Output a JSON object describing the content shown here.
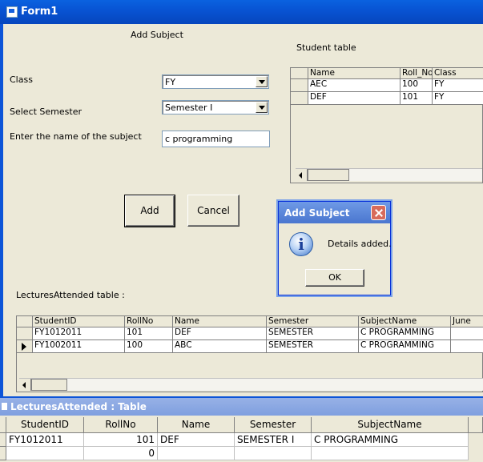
{
  "window": {
    "title": "Form1"
  },
  "form": {
    "heading": "Add Subject",
    "student_table_label": "Student table",
    "class_label": "Class",
    "class_value": "FY",
    "semester_label": "Select Semester",
    "semester_value": "Semester I",
    "subject_label": "Enter the name of the subject",
    "subject_value": "c programming",
    "add_button": "Add",
    "cancel_button": "Cancel",
    "lectures_label": "LecturesAttended table :"
  },
  "student_grid": {
    "columns": [
      "Name",
      "Roll_No",
      "Class"
    ],
    "rows": [
      [
        "AEC",
        "100",
        "FY"
      ],
      [
        "DEF",
        "101",
        "FY"
      ]
    ]
  },
  "lectures_grid": {
    "columns": [
      "StudentID",
      "RollNo",
      "Name",
      "Semester",
      "SubjectName",
      "June"
    ],
    "rows": [
      [
        "FY1012011",
        "101",
        "DEF",
        "SEMESTER",
        "C PROGRAMMING",
        ""
      ],
      [
        "FY1002011",
        "100",
        "ABC",
        "SEMESTER",
        "C PROGRAMMING",
        ""
      ]
    ],
    "selected_row": 1
  },
  "dialog": {
    "title": "Add Subject",
    "message": "Details added.",
    "ok_button": "OK",
    "icon": "info-icon"
  },
  "bottom_window": {
    "title": "LecturesAttended : Table",
    "columns": [
      "StudentID",
      "RollNo",
      "Name",
      "Semester",
      "SubjectName"
    ],
    "rows": [
      [
        "FY1012011",
        "101",
        "DEF",
        "SEMESTER I",
        "C PROGRAMMING"
      ],
      [
        "",
        "0",
        "",
        "",
        ""
      ]
    ]
  },
  "colors": {
    "titlebar": "#0854d4",
    "dialog_title": "#5884d8",
    "face": "#ece9d8"
  }
}
